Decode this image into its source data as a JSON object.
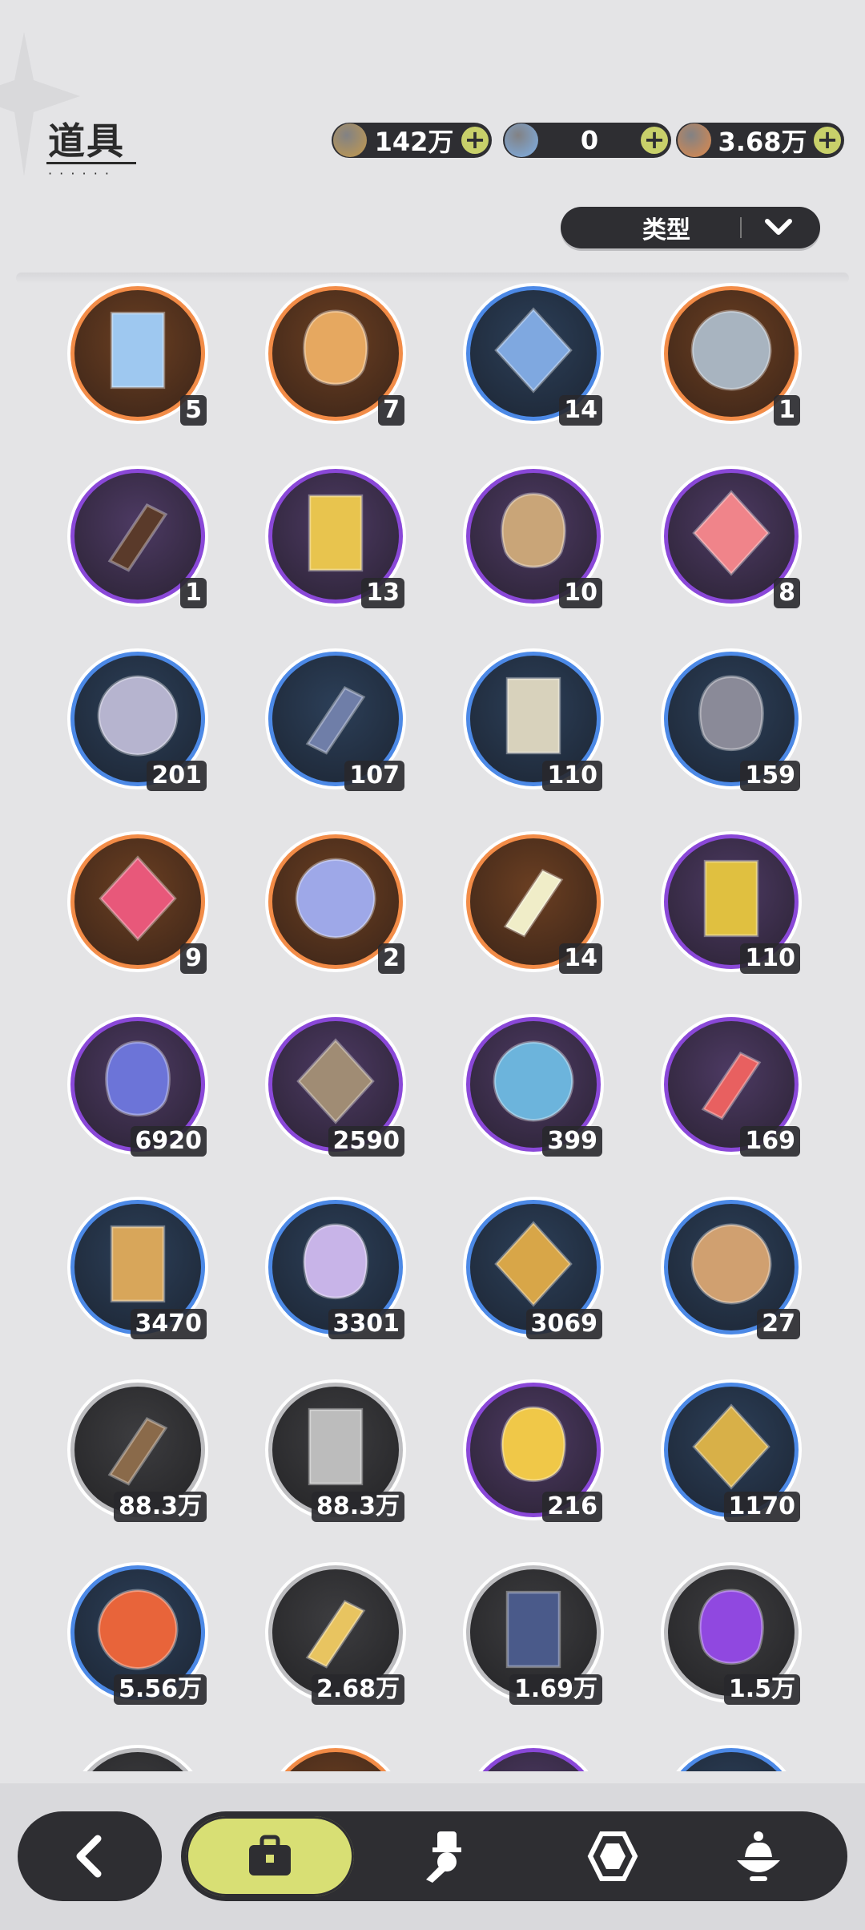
{
  "header": {
    "title": "道具"
  },
  "currencies": [
    {
      "name": "gold-coin-icon",
      "value": "142万",
      "color": "#c59a4c"
    },
    {
      "name": "crystal-icon",
      "value": "0",
      "color": "#7fb0e8"
    },
    {
      "name": "star-gem-icon",
      "value": "3.68万",
      "color": "#e0894a"
    }
  ],
  "filter": {
    "label": "类型"
  },
  "items": [
    {
      "icon": "rainbow-card-icon",
      "rarity": "orange",
      "count": "5",
      "color": "#9ec8f0"
    },
    {
      "icon": "gold-card-icon",
      "rarity": "orange",
      "count": "7",
      "color": "#e6a860"
    },
    {
      "icon": "blue-card-icon",
      "rarity": "blue",
      "count": "14",
      "color": "#7fa8e0"
    },
    {
      "icon": "silver-card-icon",
      "rarity": "orange",
      "count": "1",
      "color": "#a8b4c0"
    },
    {
      "icon": "gift-box-icon",
      "rarity": "purple",
      "count": "1",
      "color": "#5a3a2a"
    },
    {
      "icon": "golden-egg-icon",
      "rarity": "purple",
      "count": "13",
      "color": "#e8c44e"
    },
    {
      "icon": "scroll-icon",
      "rarity": "purple",
      "count": "10",
      "color": "#c9a578"
    },
    {
      "icon": "apple-icon",
      "rarity": "purple",
      "count": "8",
      "color": "#f0848a"
    },
    {
      "icon": "shovel-icon",
      "rarity": "blue",
      "count": "201",
      "color": "#b6b4cf"
    },
    {
      "icon": "boxing-glove-icon",
      "rarity": "blue",
      "count": "107",
      "color": "#6f7ea8"
    },
    {
      "icon": "pickaxe-icon",
      "rarity": "blue",
      "count": "110",
      "color": "#d8d2bc"
    },
    {
      "icon": "hammer-icon",
      "rarity": "blue",
      "count": "159",
      "color": "#8a8a98"
    },
    {
      "icon": "heart-gem-icon",
      "rarity": "orange",
      "count": "9",
      "color": "#e8587a"
    },
    {
      "icon": "shirt-token-icon",
      "rarity": "orange",
      "count": "2",
      "color": "#9ea8e8"
    },
    {
      "icon": "ticket-icon",
      "rarity": "orange",
      "count": "14",
      "color": "#f0edc8"
    },
    {
      "icon": "gold-coin-stack-icon",
      "rarity": "purple",
      "count": "110",
      "color": "#e0c040"
    },
    {
      "icon": "moon-star-medal-icon",
      "rarity": "purple",
      "count": "6920",
      "color": "#6c74d8"
    },
    {
      "icon": "fist-medal-icon",
      "rarity": "purple",
      "count": "2590",
      "color": "#a08c74"
    },
    {
      "icon": "cyan-medal-icon",
      "rarity": "purple",
      "count": "399",
      "color": "#6cb4dc"
    },
    {
      "icon": "heart-medal-icon",
      "rarity": "purple",
      "count": "169",
      "color": "#e86060"
    },
    {
      "icon": "horn-icon",
      "rarity": "blue",
      "count": "3470",
      "color": "#d8a65a"
    },
    {
      "icon": "scale-shield-icon",
      "rarity": "blue",
      "count": "3301",
      "color": "#c8b4e8"
    },
    {
      "icon": "gear-icon",
      "rarity": "blue",
      "count": "3069",
      "color": "#d8a648"
    },
    {
      "icon": "leaf-icon",
      "rarity": "blue",
      "count": "27",
      "color": "#d0a070"
    },
    {
      "icon": "wood-logs-icon",
      "rarity": "gray",
      "count": "88.3万",
      "color": "#8a6a4a"
    },
    {
      "icon": "stone-bricks-icon",
      "rarity": "gray",
      "count": "88.3万",
      "color": "#bcbcbc"
    },
    {
      "icon": "gold-crystal-icon",
      "rarity": "purple",
      "count": "216",
      "color": "#f0c848"
    },
    {
      "icon": "gold-dust-icon",
      "rarity": "blue",
      "count": "1170",
      "color": "#d8b048"
    },
    {
      "icon": "red-crystal-icon",
      "rarity": "blue",
      "count": "5.56万",
      "color": "#e8643a"
    },
    {
      "icon": "sand-pile-icon",
      "rarity": "gray",
      "count": "2.68万",
      "color": "#e8c460"
    },
    {
      "icon": "dark-crystal-icon",
      "rarity": "gray",
      "count": "1.69万",
      "color": "#4a5a8a"
    },
    {
      "icon": "purple-orb-icon",
      "rarity": "gray",
      "count": "1.5万",
      "color": "#9048e0"
    },
    {
      "icon": "partial-item-icon",
      "rarity": "gray",
      "count": "",
      "color": "#2a2a2a"
    },
    {
      "icon": "partial-item-icon",
      "rarity": "orange",
      "count": "",
      "color": "#2a2a2a"
    },
    {
      "icon": "partial-item-icon",
      "rarity": "purple",
      "count": "",
      "color": "#2a2a2a"
    },
    {
      "icon": "partial-item-icon",
      "rarity": "blue",
      "count": "",
      "color": "#2a2a2a"
    }
  ],
  "bottom_nav": {
    "back": "back-arrow-icon",
    "tabs": [
      {
        "icon": "bag-icon",
        "active": true
      },
      {
        "icon": "character-icon",
        "active": false
      },
      {
        "icon": "hexagon-gem-icon",
        "active": false
      },
      {
        "icon": "food-bowl-icon",
        "active": false
      }
    ]
  }
}
